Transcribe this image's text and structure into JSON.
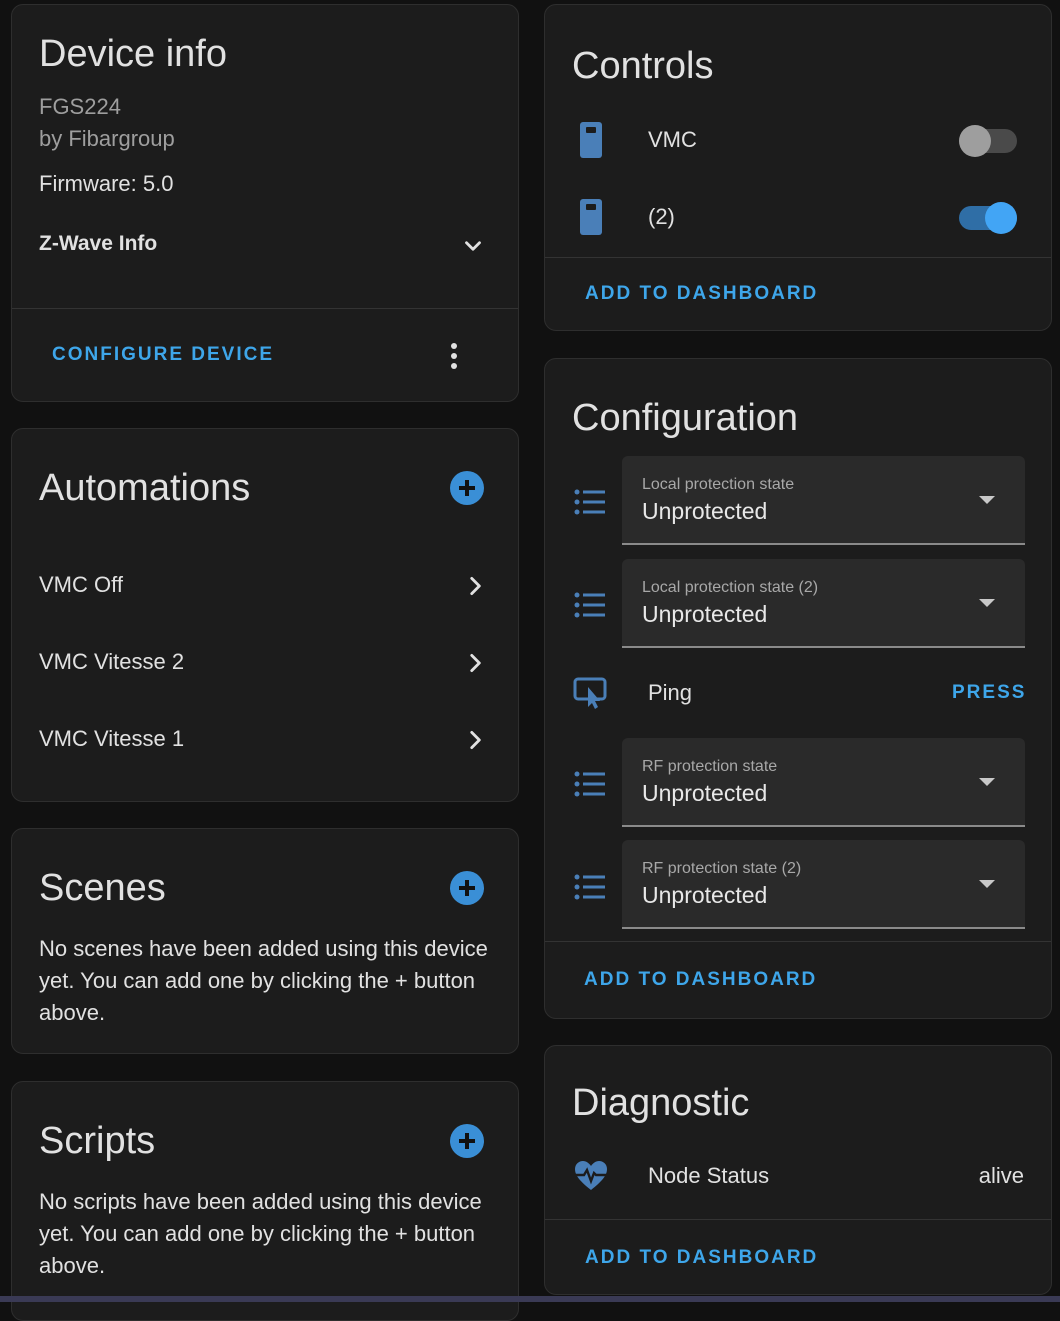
{
  "device_info": {
    "title": "Device info",
    "model": "FGS224",
    "manufacturer": "by Fibargroup",
    "firmware": "Firmware: 5.0",
    "zwave_info": "Z-Wave Info",
    "configure_label": "CONFIGURE DEVICE"
  },
  "automations": {
    "title": "Automations",
    "items": [
      {
        "label": "VMC Off"
      },
      {
        "label": "VMC Vitesse 2"
      },
      {
        "label": "VMC Vitesse 1"
      }
    ]
  },
  "scenes": {
    "title": "Scenes",
    "empty_text": "No scenes have been added using this device yet. You can add one by clicking the + button above."
  },
  "scripts": {
    "title": "Scripts",
    "empty_text": "No scripts have been added using this device yet. You can add one by clicking the + button above."
  },
  "controls": {
    "title": "Controls",
    "items": [
      {
        "label": "VMC",
        "on": false
      },
      {
        "label": "(2)",
        "on": true
      }
    ],
    "add_label": "ADD TO DASHBOARD"
  },
  "configuration": {
    "title": "Configuration",
    "selects": [
      {
        "label": "Local protection state",
        "value": "Unprotected"
      },
      {
        "label": "Local protection state (2)",
        "value": "Unprotected"
      },
      {
        "label": "RF protection state",
        "value": "Unprotected"
      },
      {
        "label": "RF protection state (2)",
        "value": "Unprotected"
      }
    ],
    "ping_label": "Ping",
    "press_label": "PRESS",
    "add_label": "ADD TO DASHBOARD"
  },
  "diagnostic": {
    "title": "Diagnostic",
    "node_status_label": "Node Status",
    "node_status_value": "alive",
    "add_label": "ADD TO DASHBOARD"
  },
  "colors": {
    "accent": "#3ea6ea",
    "icon_blue": "#4a7fb8",
    "toggle_on": "#42a5f5",
    "background": "#111111",
    "card": "#1c1c1c"
  }
}
